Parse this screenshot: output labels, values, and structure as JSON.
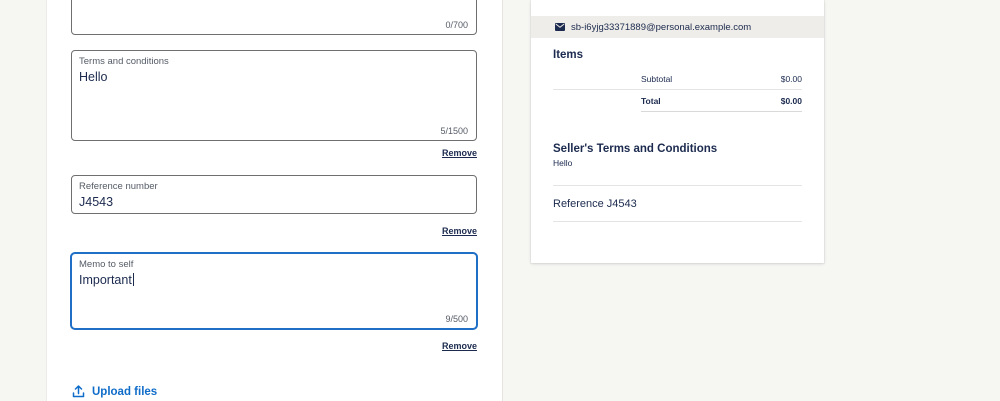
{
  "form": {
    "top_field": {
      "counter": "0/700"
    },
    "terms": {
      "label": "Terms and conditions",
      "value": "Hello",
      "counter": "5/1500",
      "remove": "Remove"
    },
    "reference": {
      "label": "Reference number",
      "value": "J4543",
      "remove": "Remove"
    },
    "memo": {
      "label": "Memo to self",
      "value": "Important",
      "counter": "9/500",
      "remove": "Remove"
    },
    "upload_label": "Upload files"
  },
  "preview": {
    "email": "sb-i6yjg33371889@personal.example.com",
    "items_title": "Items",
    "subtotal_label": "Subtotal",
    "subtotal_value": "$0.00",
    "total_label": "Total",
    "total_value": "$0.00",
    "terms_title": "Seller's Terms and Conditions",
    "terms_text": "Hello",
    "reference_text": "Reference J4543"
  },
  "colors": {
    "accent": "#1f6fc6",
    "link": "#0f6cc9",
    "text": "#1b2a4e",
    "background": "#f6f6f3"
  }
}
